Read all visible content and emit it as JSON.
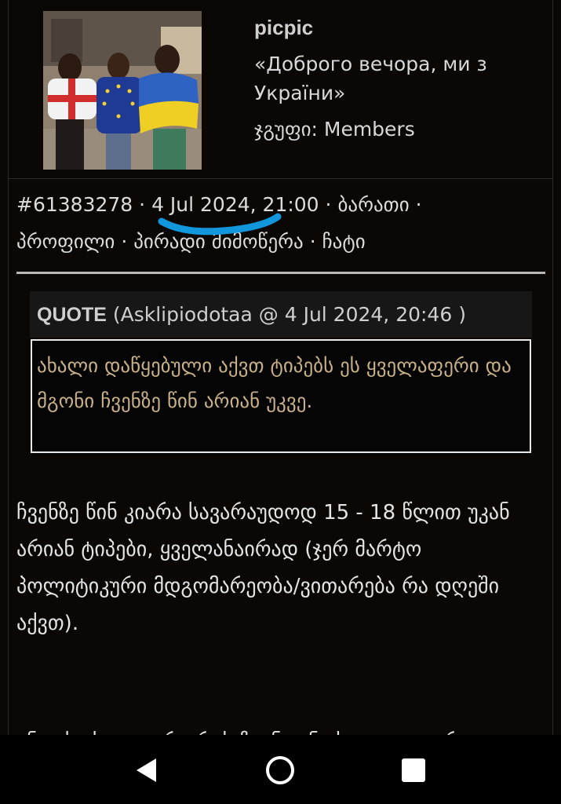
{
  "author": {
    "username": "picpic",
    "status": "«Доброго вечора, ми з України»",
    "group": "ჯგუფი: Members"
  },
  "post_meta": {
    "post_id": "#61383278",
    "datetime": "4 Jul 2024, 21:00",
    "separator": "·",
    "links": [
      "ბარათი",
      "პროფილი",
      "პირადი მიმოწერა",
      "ჩატი"
    ]
  },
  "quote": {
    "label": "QUOTE",
    "source": "(Asklipiodotaa @ 4 Jul 2024, 20:46 )",
    "text": "ახალი დაწყებული აქვთ ტიპებს ეს ყველაფერი და მგონი ჩვენზე წინ არიან უკვე."
  },
  "body": {
    "text": "ჩვენზე წინ კიარა სავარაუდოდ 15 - 18 წლით უკან არიან ტიპები, ყველანაირად (ჯერ მარტო პოლიტიკური მდგომარეობა/ვითარება რა დღეში აქვთ).",
    "clipped_line": "ანუ ეს ახალი არ არის ჩვენთან ეს ყველაფერი"
  },
  "colors": {
    "background": "#0a0704",
    "quote_text": "#c9b089",
    "highlight_stroke": "#1296dc",
    "divider": "#b8b8b8"
  },
  "navigation": {
    "buttons": [
      "back-icon",
      "home-icon",
      "recents-icon"
    ]
  }
}
